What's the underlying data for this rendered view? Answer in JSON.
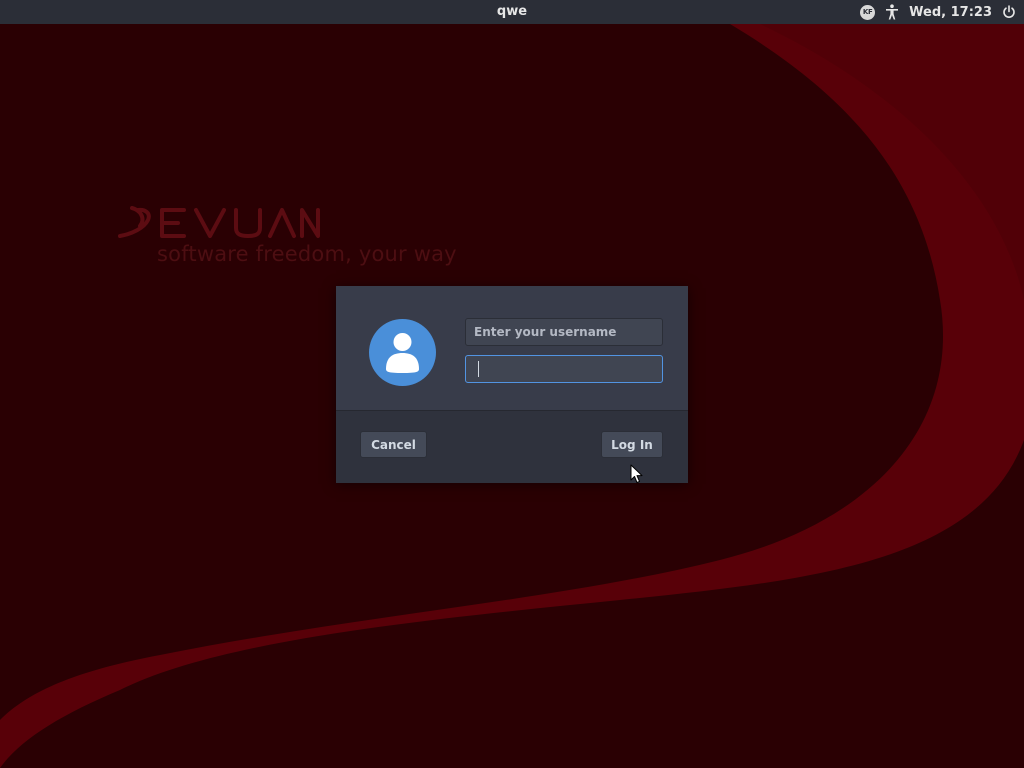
{
  "panel": {
    "title": "qwe",
    "keyboard_layout": "KF",
    "clock": "Wed, 17:23",
    "accessibility_icon": "accessibility-icon",
    "power_icon": "power-icon"
  },
  "branding": {
    "logo_text": "DEVUAN",
    "tagline": "software freedom, your way"
  },
  "login": {
    "avatar_icon": "user-avatar-icon",
    "username_placeholder": "Enter your username",
    "password_value": "",
    "cancel_label": "Cancel",
    "login_label": "Log In"
  },
  "colors": {
    "background_dark": "#2a0003",
    "wallpaper_swoosh": "#5a0008",
    "panel_bg": "#2b2e37",
    "dialog_bg": "#383c4a",
    "focus_accent": "#5294e2",
    "avatar_blue": "#4a8fd9"
  }
}
